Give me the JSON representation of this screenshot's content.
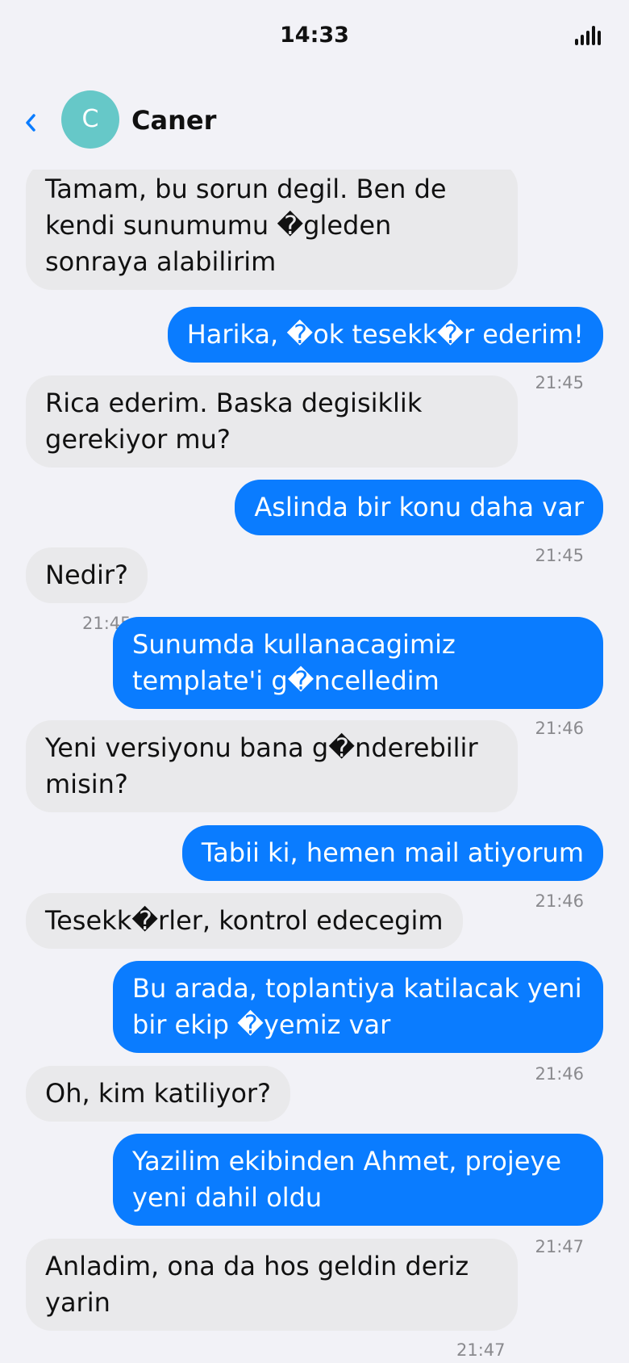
{
  "status_bar": {
    "time": "14:33"
  },
  "header": {
    "back_icon": "chevron-left-icon",
    "avatar_initial": "C",
    "contact_name": "Caner",
    "avatar_color": "#66c8c8"
  },
  "colors": {
    "outgoing": "#0a7cff",
    "incoming": "#e9e9eb",
    "background": "#f2f2f7"
  },
  "messages": [
    {
      "direction": "in",
      "text": "Tamam, bu sorun degil. Ben de kendi sunumumu �gleden sonraya alabilirim",
      "time": ""
    },
    {
      "direction": "out",
      "text": "Harika, �ok tesekk�r ederim!",
      "time": "21:45"
    },
    {
      "direction": "in",
      "text": "Rica ederim. Baska degisiklik gerekiyor mu?",
      "time": ""
    },
    {
      "direction": "out",
      "text": "Aslinda bir konu daha var",
      "time": "21:45"
    },
    {
      "direction": "in",
      "text": "Nedir?",
      "time": "21:45"
    },
    {
      "direction": "out",
      "text": "Sunumda kullanacagimiz template'i g�ncelledim",
      "time": "21:46"
    },
    {
      "direction": "in",
      "text": "Yeni versiyonu bana g�nderebilir misin?",
      "time": ""
    },
    {
      "direction": "out",
      "text": "Tabii ki, hemen mail atiyorum",
      "time": "21:46"
    },
    {
      "direction": "in",
      "text": "Tesekk�rler, kontrol edecegim",
      "time": ""
    },
    {
      "direction": "out",
      "text": "Bu arada, toplantiya katilacak yeni bir ekip �yemiz var",
      "time": "21:46"
    },
    {
      "direction": "in",
      "text": "Oh, kim katiliyor?",
      "time": ""
    },
    {
      "direction": "out",
      "text": "Yazilim ekibinden Ahmet, projeye yeni dahil oldu",
      "time": "21:47"
    },
    {
      "direction": "in",
      "text": "Anladim, ona da hos geldin deriz yarin",
      "time": "21:47"
    }
  ]
}
